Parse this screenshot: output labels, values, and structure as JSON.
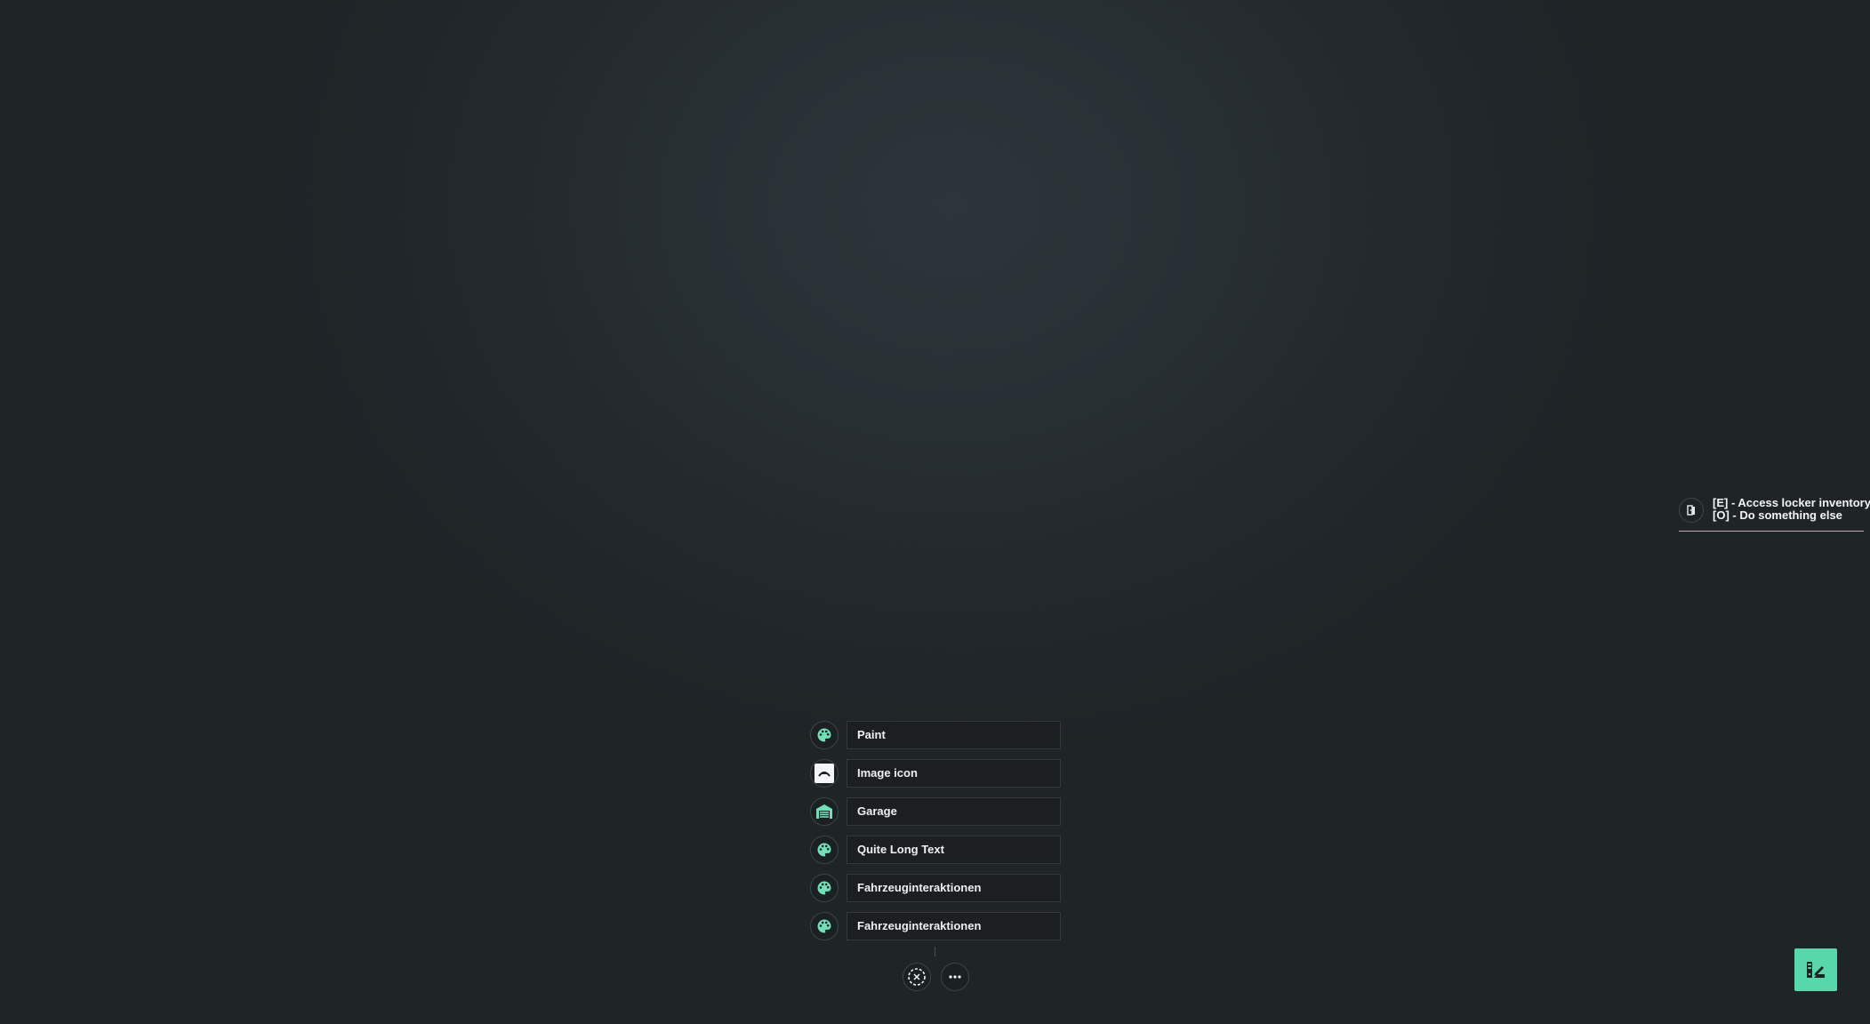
{
  "hint": {
    "icon": "locker-door-icon",
    "lines": [
      "[E] - Access locker inventory",
      "[O] - Do something else"
    ]
  },
  "menu": {
    "items": [
      {
        "label": "Paint",
        "icon": "palette-icon"
      },
      {
        "label": "Image icon",
        "icon": "image-icon"
      },
      {
        "label": "Garage",
        "icon": "garage-icon"
      },
      {
        "label": "Quite Long Text",
        "icon": "palette-icon"
      },
      {
        "label": "Fahrzeuginteraktionen",
        "icon": "palette-icon"
      },
      {
        "label": "Fahrzeuginteraktionen",
        "icon": "palette-icon"
      }
    ],
    "close_icon": "close-circle-icon",
    "more_icon": "more-horizontal-icon"
  },
  "fab": {
    "icon": "swatch-edit-icon"
  },
  "colors": {
    "accent": "#58d7aa",
    "icon_fill": "#6fe0b8",
    "panel": "#1b1f22",
    "background": "#22282c"
  }
}
